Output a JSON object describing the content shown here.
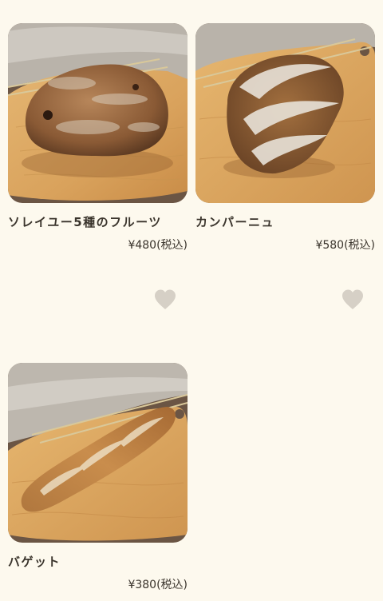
{
  "products": [
    {
      "name": "ソレイユー5種のフルーツ",
      "price": "¥480(税込)",
      "image_alt": "round fruit bread on wooden board",
      "favorite_icon": "heart-icon"
    },
    {
      "name": "カンパーニュ",
      "price": "¥580(税込)",
      "image_alt": "campagne loaf on wooden board",
      "favorite_icon": "heart-icon"
    },
    {
      "name": "バゲット",
      "price": "¥380(税込)",
      "image_alt": "baguette on wooden board"
    }
  ],
  "colors": {
    "background": "#fdf9ee",
    "text": "#3a342c",
    "heart": "#d6d0c6"
  }
}
